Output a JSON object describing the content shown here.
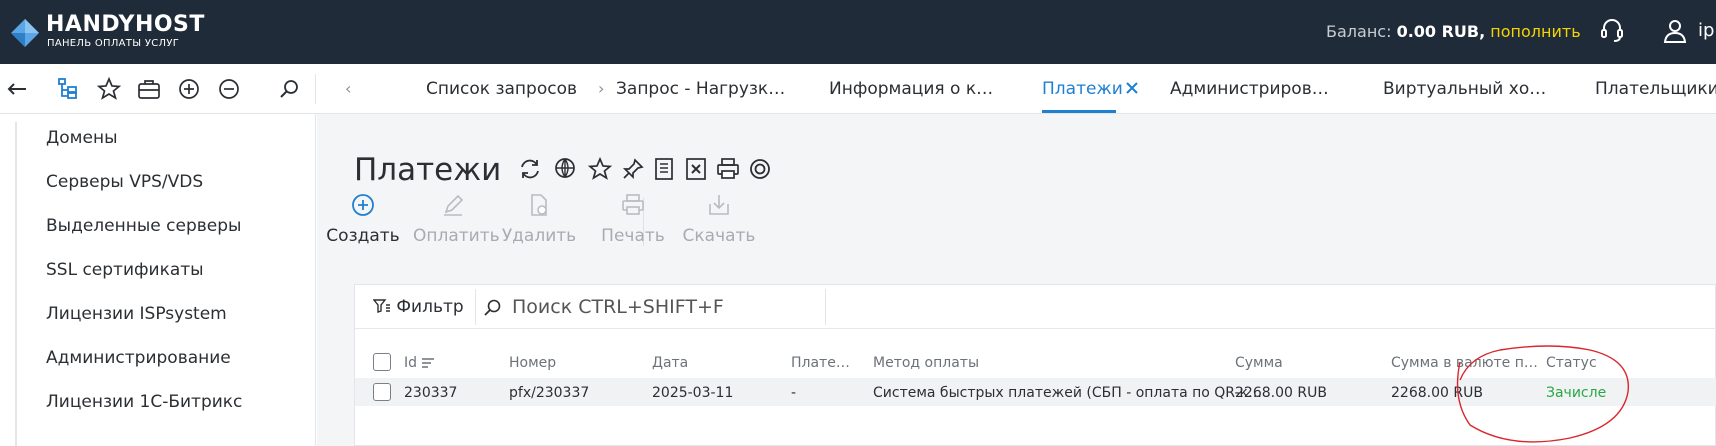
{
  "header": {
    "logo_name": "HANDYHOST",
    "logo_sub": "ПАНЕЛЬ ОПЛАТЫ УСЛУГ",
    "balance_label": "Баланс:",
    "balance_amount": "0.00 RUB,",
    "topup_label": "пополнить",
    "user": "ip"
  },
  "tabs": [
    {
      "label": "Список запросов"
    },
    {
      "label": "Запрос - Нагрузк…"
    },
    {
      "label": "Информация о к…"
    },
    {
      "label": "Платежи",
      "active": true
    },
    {
      "label": "Администриров…"
    },
    {
      "label": "Виртуальный хо…"
    },
    {
      "label": "Плательщики"
    }
  ],
  "sidebar": {
    "items": [
      {
        "label": "Домены"
      },
      {
        "label": "Серверы VPS/VDS"
      },
      {
        "label": "Выделенные серверы"
      },
      {
        "label": "SSL сертификаты"
      },
      {
        "label": "Лицензии ISPsystem"
      },
      {
        "label": "Администрирование"
      },
      {
        "label": "Лицензии 1С-Битрикс"
      }
    ]
  },
  "page": {
    "title": "Платежи"
  },
  "actions": [
    {
      "label": "Создать",
      "enabled": true,
      "icon": "plus-circle-icon"
    },
    {
      "label": "Оплатить",
      "enabled": false,
      "icon": "pencil-icon"
    },
    {
      "label": "Удалить",
      "enabled": false,
      "icon": "delete-doc-icon"
    },
    {
      "label": "Печать",
      "enabled": false,
      "icon": "printer-icon"
    },
    {
      "label": "Скачать",
      "enabled": false,
      "icon": "download-icon"
    }
  ],
  "filter": {
    "label": "Фильтр",
    "search_placeholder": "Поиск CTRL+SHIFT+F"
  },
  "table": {
    "columns": [
      "Id",
      "Номер",
      "Дата",
      "Плате…",
      "Метод оплаты",
      "Сумма",
      "Сумма в валюте п…",
      "Статус"
    ],
    "rows": [
      {
        "id": "230337",
        "number": "pfx/230337",
        "date": "2025-03-11",
        "payer": "-",
        "method": "Система быстрых платежей (СБП - оплата по QR-к…",
        "amount": "2268.00 RUB",
        "amount_currency": "2268.00 RUB",
        "status": "Зачисле"
      }
    ]
  },
  "colors": {
    "header_bg": "#1f2b39",
    "accent": "#1f7fd1",
    "topup": "#f5d400",
    "status_ok": "#27a844",
    "annotation": "#d9262c"
  }
}
